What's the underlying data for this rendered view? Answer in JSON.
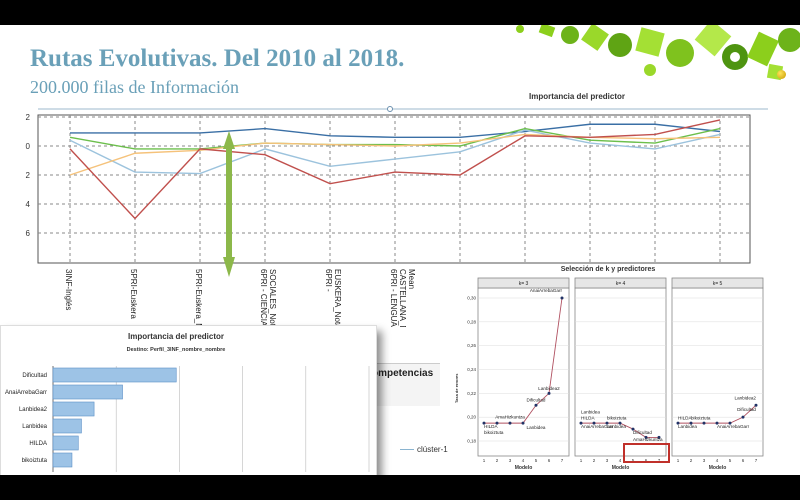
{
  "slide": {
    "title": "Rutas Evolutivas. Del 2010 al 2018.",
    "subtitle": "200.000 filas de Información"
  },
  "top_chart": {
    "title": "Importancia del predictor",
    "ytick_labels": [
      "2",
      "0",
      "2",
      "4",
      "6"
    ],
    "categories": [
      "3INF-Inglés",
      "5PRI-Euskera",
      "5PRI-Euskera_Música",
      "6PRI - CIENCIAS SOCIALES_Nota_balila",
      "6PRI - EUSKERA_Nota_balila",
      "6PRI - LENGUA CASTELLANA_Nota_balila_Mean"
    ],
    "category_lines": [
      [
        "3INF-Inglés"
      ],
      [
        "5PRI-Euskera"
      ],
      [
        "5PRI-Euskera_Músic"
      ],
      [
        "6PRI - CIENCIAS",
        "SOCIALES_Nota_bali"
      ],
      [
        "6PRI -",
        "EUSKERA_Nota_bali"
      ],
      [
        "6PRI - LENGUA",
        "CASTELLANA_Nota_balila",
        "Mean"
      ]
    ],
    "colors": {
      "blue": "#3a6fa5",
      "green": "#6cbf4c",
      "red": "#c0504d",
      "lightblue": "#9cc3dd",
      "orange": "#f5c27a",
      "arrow": "#8cb84a"
    }
  },
  "selection_chart": {
    "title": "Selección de k y predictores",
    "panels": [
      "k= 3",
      "k= 4",
      "k= 5"
    ],
    "ylabel": "Tasa de errores",
    "xlabel": "Modelo",
    "ytick_labels": [
      "0,30",
      "0,28",
      "0,26",
      "0,24",
      "0,22",
      "0,20",
      "0,18"
    ],
    "xtick_labels": [
      "1",
      "2",
      "3",
      "4",
      "5",
      "6",
      "7"
    ],
    "point_labels": {
      "k3": [
        "AnaiArrebaGarr",
        "Lanbidea2",
        "Dificultad",
        "AmaHizkuntza",
        "Lanbidea",
        "HILDA",
        "bikoiztuta"
      ],
      "k4": [
        "Lanbidea",
        "HILDA",
        "bikoiztuta",
        "AnaiArrebaGarr",
        "Lanbidea",
        "Dificultad",
        "AmaHizkuntza"
      ],
      "k5": [
        "Lanbidea2",
        "Dificultad",
        "HILDA",
        "bikoiztuta",
        "Lanbidea",
        "AnaiArrebaGarr"
      ]
    }
  },
  "importance_panel": {
    "title": "Importancia del predictor",
    "subtitle": "Destino: Perfil_3INF_nombre_nombre",
    "chart_data": {
      "type": "bar",
      "orientation": "horizontal",
      "categories": [
        "Dificultad",
        "AnaiArrebaGarr",
        "Lanbidea2",
        "Lanbidea",
        "HILDA",
        "bikoiztuta"
      ],
      "values": [
        0.39,
        0.22,
        0.13,
        0.09,
        0.08,
        0.06
      ],
      "xlim": [
        0,
        1.0
      ],
      "xtick_labels": [
        "0,0",
        "0,2",
        "0,4",
        "0,6",
        "0,8",
        "1,0"
      ]
    }
  },
  "fragment": {
    "text": "ompetencias"
  },
  "legend_fragment": {
    "text": "clúster-1"
  }
}
